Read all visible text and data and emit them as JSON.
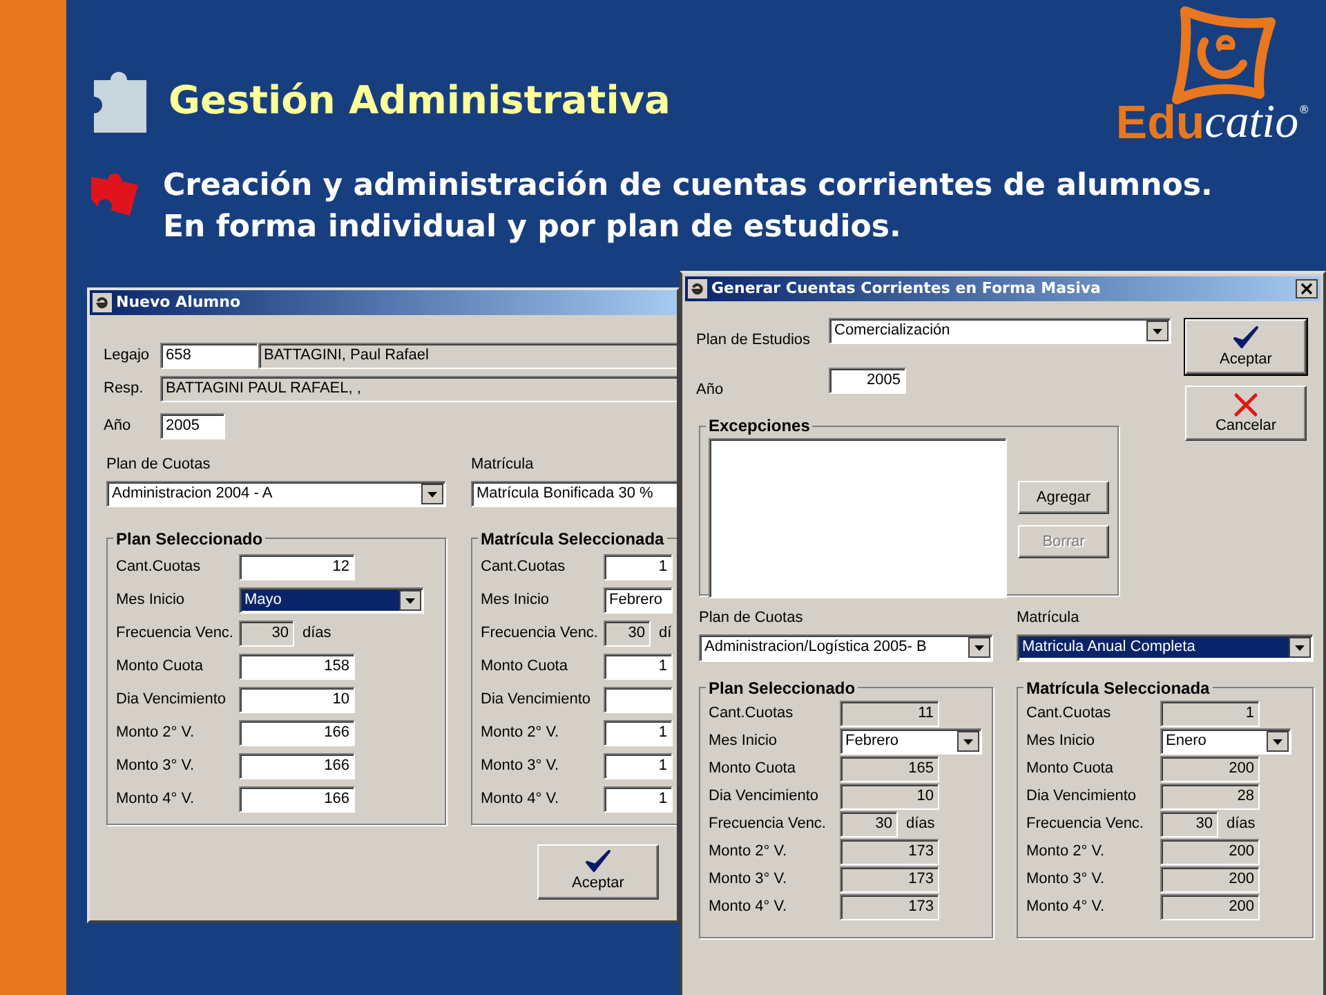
{
  "slide": {
    "title": "Gestión Administrativa",
    "bullet": "Creación y administración de cuentas corrientes de alumnos. En forma individual y por plan de estudios."
  },
  "logo": {
    "prefix": "Edu",
    "suffix": "catio",
    "mark": "®"
  },
  "windows": [
    {
      "title": "Nuevo Alumno",
      "legajo": {
        "label": "Legajo",
        "value": "658",
        "name": "BATTAGINI, Paul Rafael"
      },
      "resp": {
        "label": "Resp.",
        "value": "BATTAGINI PAUL RAFAEL, ,"
      },
      "anio": {
        "label": "Año",
        "value": "2005"
      },
      "plan_de_cuotas": {
        "label": "Plan de Cuotas",
        "value": "Administracion 2004 - A",
        "highlighted": false
      },
      "matricula": {
        "label": "Matrícula",
        "value": "Matrícula Bonificada 30 %",
        "highlighted": false
      },
      "groups": [
        {
          "title": "Plan Seleccionado",
          "rows": [
            {
              "label": "Cant.Cuotas",
              "kind": "text",
              "value": "12"
            },
            {
              "label": "Mes Inicio",
              "kind": "combo",
              "value": "Mayo",
              "highlighted": true
            },
            {
              "label": "Frecuencia Venc.",
              "kind": "readonly",
              "value": "30",
              "suffix": "días"
            },
            {
              "label": "Monto Cuota",
              "kind": "text",
              "value": "158"
            },
            {
              "label": "Dia Vencimiento",
              "kind": "text",
              "value": "10"
            },
            {
              "label": "Monto 2° V.",
              "kind": "text",
              "value": "166"
            },
            {
              "label": "Monto 3° V.",
              "kind": "text",
              "value": "166"
            },
            {
              "label": "Monto 4° V.",
              "kind": "text",
              "value": "166"
            }
          ]
        },
        {
          "title": "Matrícula Seleccionada",
          "rows": [
            {
              "label": "Cant.Cuotas",
              "kind": "text",
              "value": "1"
            },
            {
              "label": "Mes Inicio",
              "kind": "combo",
              "value": "Febrero",
              "highlighted": false
            },
            {
              "label": "Frecuencia Venc.",
              "kind": "readonly",
              "value": "30",
              "suffix": "dí"
            },
            {
              "label": "Monto Cuota",
              "kind": "text",
              "value": "1"
            },
            {
              "label": "Dia Vencimiento",
              "kind": "text"
            },
            {
              "label": "Monto 2° V.",
              "kind": "text",
              "value": "1"
            },
            {
              "label": "Monto 3° V.",
              "kind": "text",
              "value": "1"
            },
            {
              "label": "Monto 4° V.",
              "kind": "text",
              "value": "1"
            }
          ]
        }
      ],
      "buttons": [
        {
          "label": "Aceptar",
          "kind": "confirm",
          "default": false,
          "disabled": false
        }
      ]
    },
    {
      "title": "Generar Cuentas Corrientes en Forma Masiva",
      "plan_de_estudios": {
        "label": "Plan de Estudios",
        "value": "Comercialización",
        "highlighted": false
      },
      "anio": {
        "label": "Año",
        "value": "2005"
      },
      "excepciones": {
        "title": "Excepciones",
        "buttons": [
          {
            "label": "Agregar",
            "disabled": false
          },
          {
            "label": "Borrar",
            "disabled": true
          }
        ]
      },
      "buttons": [
        {
          "label": "Aceptar",
          "kind": "confirm",
          "default": true,
          "disabled": false
        },
        {
          "label": "Cancelar",
          "kind": "cancel",
          "default": false,
          "disabled": false
        }
      ],
      "plan_de_cuotas": {
        "label": "Plan de Cuotas",
        "value": "Administracion/Logística 2005- B",
        "highlighted": false
      },
      "matricula": {
        "label": "Matrícula",
        "value": "Matricula Anual Completa",
        "highlighted": true
      },
      "groups": [
        {
          "title": "Plan Seleccionado",
          "rows": [
            {
              "label": "Cant.Cuotas",
              "kind": "readonly",
              "value": "11"
            },
            {
              "label": "Mes Inicio",
              "kind": "combo",
              "value": "Febrero",
              "highlighted": false
            },
            {
              "label": "Monto Cuota",
              "kind": "readonly",
              "value": "165"
            },
            {
              "label": "Dia Vencimiento",
              "kind": "readonly",
              "value": "10"
            },
            {
              "label": "Frecuencia Venc.",
              "kind": "readonly",
              "value": "30",
              "suffix": "días"
            },
            {
              "label": "Monto 2° V.",
              "kind": "readonly",
              "value": "173"
            },
            {
              "label": "Monto 3° V.",
              "kind": "readonly",
              "value": "173"
            },
            {
              "label": "Monto 4° V.",
              "kind": "readonly",
              "value": "173"
            }
          ]
        },
        {
          "title": "Matrícula Seleccionada",
          "rows": [
            {
              "label": "Cant.Cuotas",
              "kind": "readonly",
              "value": "1"
            },
            {
              "label": "Mes Inicio",
              "kind": "combo",
              "value": "Enero",
              "highlighted": false
            },
            {
              "label": "Monto Cuota",
              "kind": "readonly",
              "value": "200"
            },
            {
              "label": "Dia Vencimiento",
              "kind": "readonly",
              "value": "28"
            },
            {
              "label": "Frecuencia Venc.",
              "kind": "readonly",
              "value": "30",
              "suffix": "días"
            },
            {
              "label": "Monto 2° V.",
              "kind": "readonly",
              "value": "200"
            },
            {
              "label": "Monto 3° V.",
              "kind": "readonly",
              "value": "200"
            },
            {
              "label": "Monto 4° V.",
              "kind": "readonly",
              "value": "200"
            }
          ]
        }
      ]
    }
  ]
}
